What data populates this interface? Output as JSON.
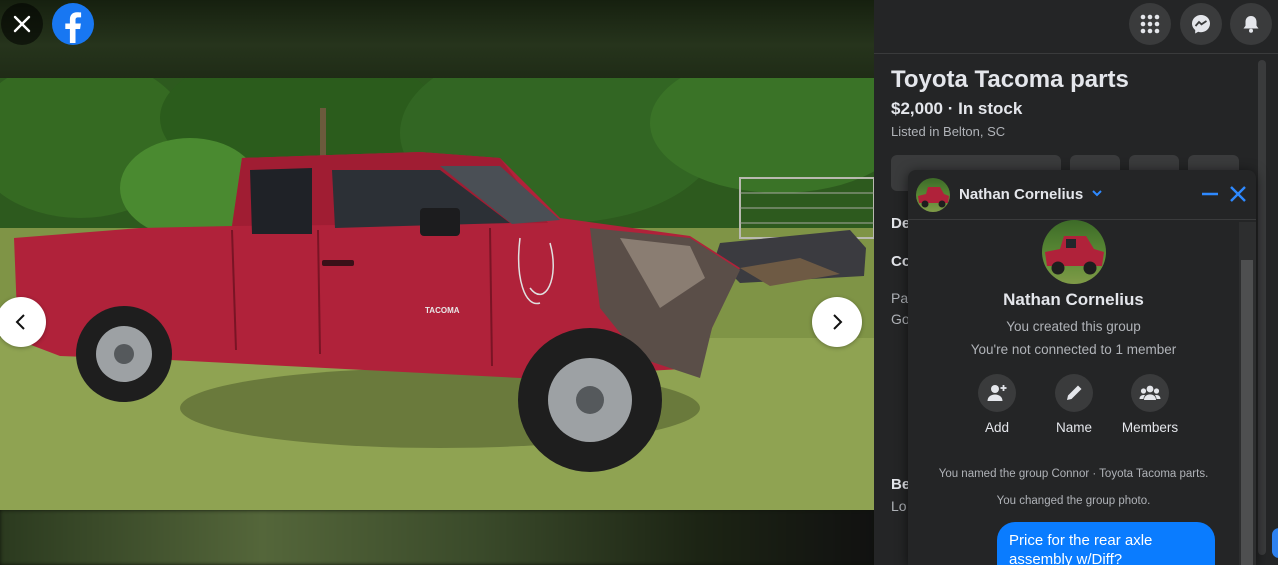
{
  "viewer": {
    "close_icon": "close-icon",
    "logo_icon": "facebook-logo-icon",
    "prev_icon": "chevron-left-icon",
    "next_icon": "chevron-right-icon",
    "photo_truck_badge": "TACOMA"
  },
  "topbar": {
    "icons": [
      "grid-menu-icon",
      "messenger-icon",
      "bell-icon"
    ]
  },
  "listing": {
    "title": "Toyota Tacoma parts",
    "price_status": "$2,000 · In stock",
    "location": "Listed in Belton, SC",
    "partial_left_texts": [
      "De",
      "Co",
      "Pa",
      "Go",
      "Be",
      "Lo"
    ]
  },
  "chat": {
    "header_name": "Nathan Cornelius",
    "group_name": "Nathan Cornelius",
    "created_line": "You created this group",
    "connected_line": "You're not connected to 1 member",
    "actions": [
      {
        "label": "Add",
        "icon": "add-person-icon"
      },
      {
        "label": "Name",
        "icon": "pencil-icon"
      },
      {
        "label": "Members",
        "icon": "members-icon"
      }
    ],
    "system_messages": [
      "You named the group Connor · Toyota Tacoma parts.",
      "You changed the group photo."
    ],
    "bubble_text": "Price for the rear axle assembly w/Diff?"
  },
  "colors": {
    "panel_bg": "#242526",
    "accent_blue": "#1877f2",
    "bubble_blue": "#0a7cff",
    "text_primary": "#e4e6eb",
    "text_secondary": "#b0b3b8",
    "truck_red": "#b0223a"
  }
}
